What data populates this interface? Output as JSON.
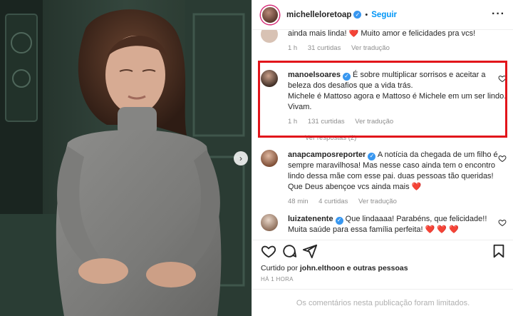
{
  "header": {
    "username": "michelleloretoap",
    "follow_label": "Seguir",
    "separator": "•"
  },
  "comments": [
    {
      "text_pre": "ainda mais linda! ",
      "emoji": "❤️",
      "text_post": " Muito amor e felicidades pra vcs!",
      "time": "1 h",
      "likes": "31 curtidas",
      "translate": "Ver tradução"
    },
    {
      "username": "manoelsoares",
      "text": "É sobre multiplicar sorrisos e aceitar a beleza dos desafios que a vida trás.",
      "text2": "Michele é Mattoso agora e Mattoso é Michele em um ser lindo. Vivam.",
      "time": "1 h",
      "likes": "131 curtidas",
      "translate": "Ver tradução",
      "replies": "Ver respostas (2)"
    },
    {
      "username": "anapcamposreporter",
      "text": "A notícia da chegada de um filho é sempre maravilhosa! Mas nesse caso ainda tem o encontro lindo dessa mãe com esse pai. duas pessoas tão queridas! Que Deus abençoe vcs ainda mais ",
      "emoji": "❤️",
      "time": "48 min",
      "likes": "4 curtidas",
      "translate": "Ver tradução"
    },
    {
      "username": "luizatenente",
      "text": "Que lindaaaa! Parabéns, que felicidade!! Muita saúde para essa família perfeita! ",
      "emoji": "❤️ ❤️ ❤️"
    }
  ],
  "likes_line": {
    "prefix": "Curtido por ",
    "user": "john.elthoon",
    "suffix": " e outras pessoas"
  },
  "timestamp": "HÁ 1 HORA",
  "comments_limited": "Os comentários nesta publicação foram limitados.",
  "icons": {
    "more": "more-horizontal-icon",
    "like": "heart-icon",
    "comment": "comment-icon",
    "share": "share-icon",
    "save": "bookmark-icon",
    "next": "chevron-right-icon"
  },
  "colors": {
    "accent": "#0095f6",
    "verified": "#3897f0",
    "highlight": "#e2151b",
    "heart": "#ed1c24"
  }
}
